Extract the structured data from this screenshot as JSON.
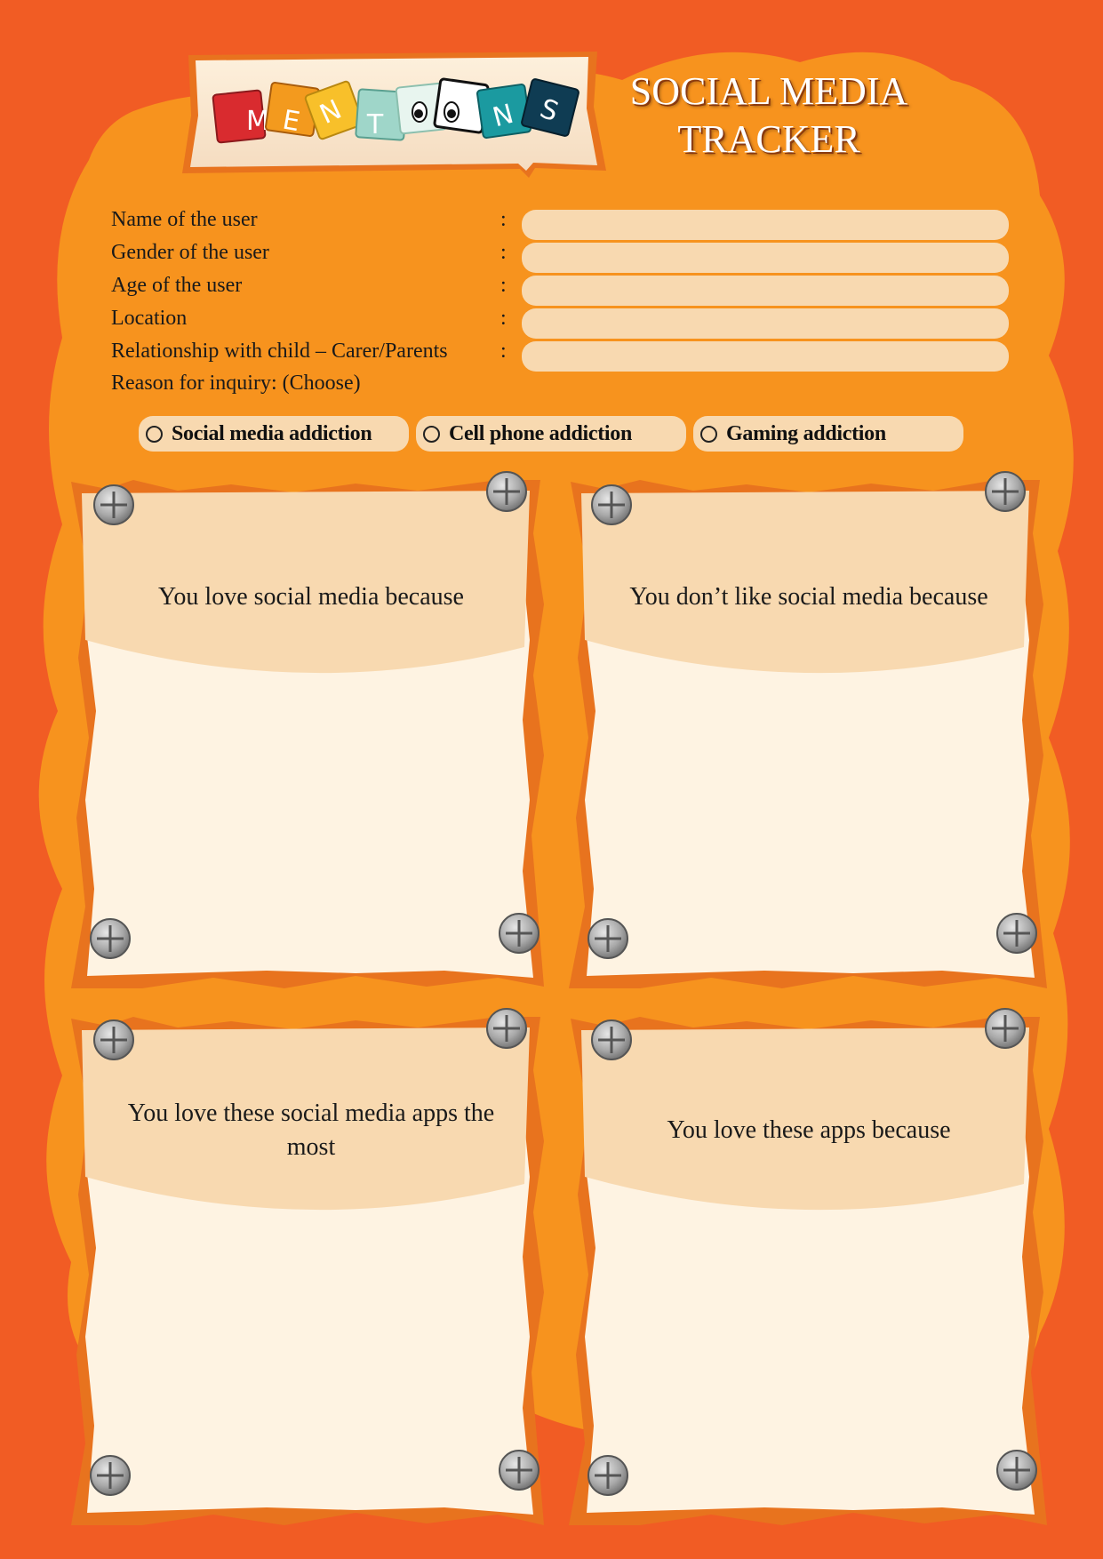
{
  "header": {
    "logo_letters": [
      "M",
      "E",
      "N",
      "T",
      "O",
      "O",
      "N",
      "S"
    ],
    "title_line1": "SOCIAL MEDIA",
    "title_line2": "TRACKER"
  },
  "form": {
    "fields": [
      {
        "label": "Name of the user",
        "value": ""
      },
      {
        "label": "Gender of the user",
        "value": ""
      },
      {
        "label": "Age of the user",
        "value": ""
      },
      {
        "label": "Location",
        "value": ""
      },
      {
        "label": "Relationship with child – Carer/Parents",
        "value": ""
      }
    ],
    "colon": ":",
    "reason_label": "Reason for inquiry: (Choose)",
    "options": [
      "Social media addiction",
      "Cell phone addiction",
      "Gaming addiction"
    ]
  },
  "cards": [
    {
      "heading": "You love social media because"
    },
    {
      "heading": "You don’t like social media because"
    },
    {
      "heading": "You love these social media apps the most"
    },
    {
      "heading": "You love these apps because"
    }
  ],
  "colors": {
    "background": "#f15c24",
    "blob": "#f7931e",
    "card_header": "#f8d9b0",
    "card_body": "#fef3e2",
    "card_border": "#e8731e"
  }
}
